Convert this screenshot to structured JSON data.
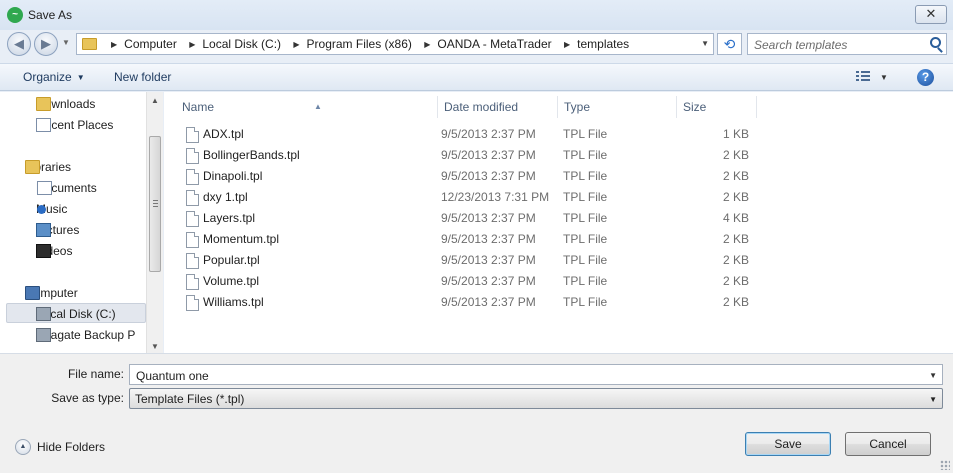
{
  "window": {
    "title": "Save As"
  },
  "address": {
    "crumbs": [
      "Computer",
      "Local Disk (C:)",
      "Program Files (x86)",
      "OANDA - MetaTrader",
      "templates"
    ]
  },
  "search": {
    "placeholder": "Search templates"
  },
  "toolbar": {
    "organize_label": "Organize",
    "new_folder_label": "New folder"
  },
  "nav": {
    "items": [
      {
        "label": "Downloads",
        "icon": "downloads-folder-icon"
      },
      {
        "label": "Recent Places",
        "icon": "recent-places-icon"
      },
      {
        "label": "Libraries",
        "icon": "libraries-icon"
      },
      {
        "label": "Documents",
        "icon": "documents-icon"
      },
      {
        "label": "Music",
        "icon": "music-icon"
      },
      {
        "label": "Pictures",
        "icon": "pictures-icon"
      },
      {
        "label": "Videos",
        "icon": "videos-icon"
      },
      {
        "label": "Computer",
        "icon": "computer-icon"
      },
      {
        "label": "Local Disk (C:)",
        "icon": "hard-disk-icon",
        "selected": true
      },
      {
        "label": "Seagate Backup P",
        "icon": "external-drive-icon"
      }
    ]
  },
  "files": {
    "columns": [
      "Name",
      "Date modified",
      "Type",
      "Size"
    ],
    "rows": [
      {
        "name": "ADX.tpl",
        "date": "9/5/2013 2:37 PM",
        "type": "TPL File",
        "size": "1 KB"
      },
      {
        "name": "BollingerBands.tpl",
        "date": "9/5/2013 2:37 PM",
        "type": "TPL File",
        "size": "2 KB"
      },
      {
        "name": "Dinapoli.tpl",
        "date": "9/5/2013 2:37 PM",
        "type": "TPL File",
        "size": "2 KB"
      },
      {
        "name": "dxy 1.tpl",
        "date": "12/23/2013 7:31 PM",
        "type": "TPL File",
        "size": "2 KB"
      },
      {
        "name": "Layers.tpl",
        "date": "9/5/2013 2:37 PM",
        "type": "TPL File",
        "size": "4 KB"
      },
      {
        "name": "Momentum.tpl",
        "date": "9/5/2013 2:37 PM",
        "type": "TPL File",
        "size": "2 KB"
      },
      {
        "name": "Popular.tpl",
        "date": "9/5/2013 2:37 PM",
        "type": "TPL File",
        "size": "2 KB"
      },
      {
        "name": "Volume.tpl",
        "date": "9/5/2013 2:37 PM",
        "type": "TPL File",
        "size": "2 KB"
      },
      {
        "name": "Williams.tpl",
        "date": "9/5/2013 2:37 PM",
        "type": "TPL File",
        "size": "2 KB"
      }
    ]
  },
  "form": {
    "file_name_label": "File name:",
    "file_name_value": "Quantum one",
    "save_type_label": "Save as type:",
    "save_type_value": "Template Files (*.tpl)"
  },
  "footer": {
    "hide_folders_label": "Hide Folders",
    "save_label": "Save",
    "cancel_label": "Cancel"
  },
  "colors": {
    "title_bg": "#dfe8f4",
    "pane_bg": "#ffffff",
    "footer_bg": "#f0f0f0",
    "accent": "#3c7fb1"
  }
}
